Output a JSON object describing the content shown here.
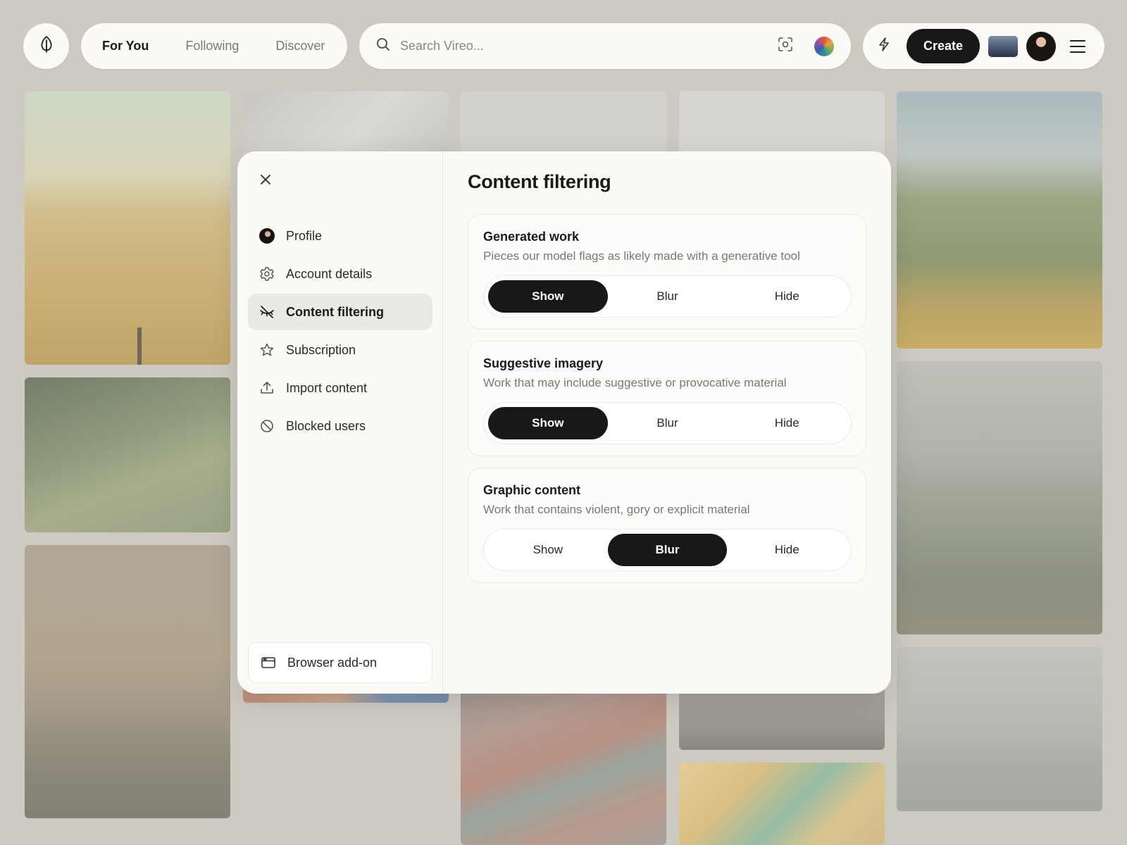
{
  "nav": {
    "logo_icon": "leaf-icon",
    "tabs": [
      {
        "label": "For You",
        "active": true
      },
      {
        "label": "Following",
        "active": false
      },
      {
        "label": "Discover",
        "active": false
      }
    ]
  },
  "search": {
    "placeholder": "Search Vireo...",
    "search_icon": "search-icon",
    "visual_search_icon": "scan-icon",
    "color_icon": "color-wheel-icon"
  },
  "actions": {
    "bolt_icon": "lightning-icon",
    "create_label": "Create",
    "menu_icon": "hamburger-menu-icon"
  },
  "modal": {
    "close_icon": "close-icon",
    "menu": [
      {
        "label": "Profile",
        "icon": "avatar",
        "active": false
      },
      {
        "label": "Account details",
        "icon": "gear-icon",
        "active": false
      },
      {
        "label": "Content filtering",
        "icon": "eye-off-icon",
        "active": true
      },
      {
        "label": "Subscription",
        "icon": "star-icon",
        "active": false
      },
      {
        "label": "Import content",
        "icon": "upload-icon",
        "active": false
      },
      {
        "label": "Blocked users",
        "icon": "blocked-icon",
        "active": false
      }
    ],
    "addon": {
      "label": "Browser add-on",
      "icon": "browser-window-icon"
    },
    "content": {
      "title": "Content filtering",
      "options": [
        "Show",
        "Blur",
        "Hide"
      ],
      "cards": [
        {
          "title": "Generated work",
          "description": "Pieces our model flags as likely made with a generative tool",
          "selected": "Show"
        },
        {
          "title": "Suggestive imagery",
          "description": "Work that may include suggestive or provocative material",
          "selected": "Show"
        },
        {
          "title": "Graphic content",
          "description": "Work that contains violent, gory or explicit material",
          "selected": "Blur"
        }
      ]
    }
  },
  "colors": {
    "accent": "#181818",
    "background": "#c9c6be",
    "surface": "#fbfaf7",
    "muted_text": "#7a7874"
  }
}
